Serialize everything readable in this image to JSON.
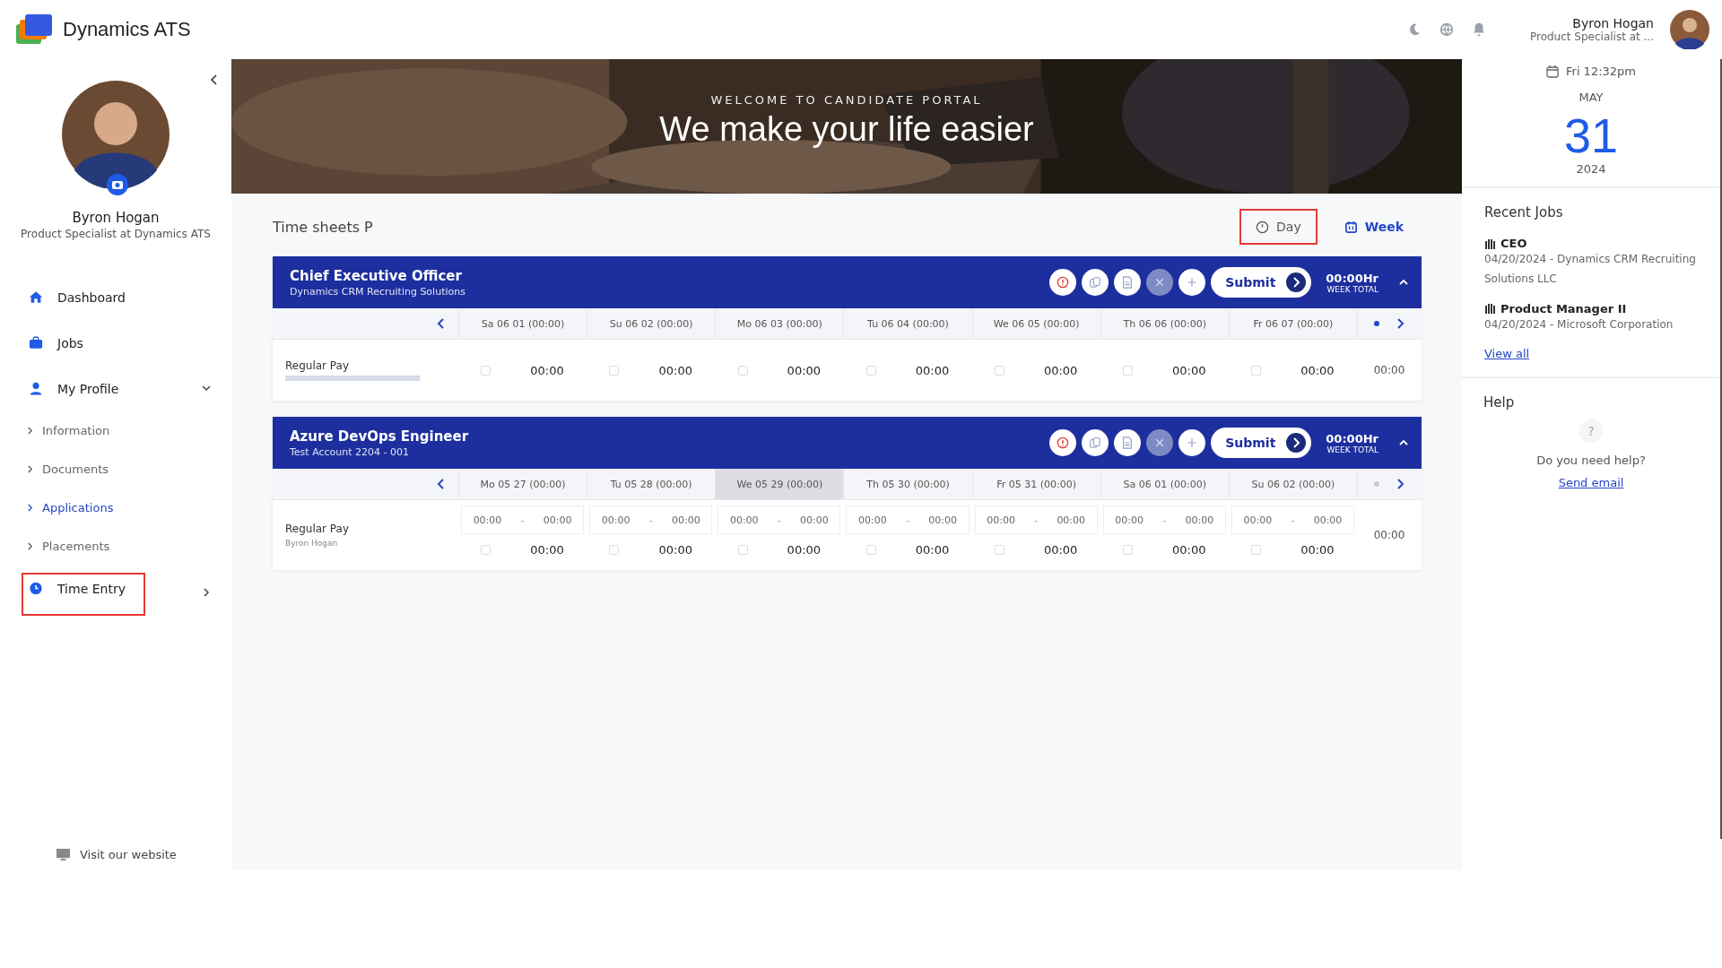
{
  "app": {
    "name": "Dynamics ATS"
  },
  "header": {
    "user_name": "Byron Hogan",
    "user_title": "Product Specialist at ..."
  },
  "sidebar": {
    "profile": {
      "name": "Byron Hogan",
      "title": "Product Specialist at Dynamics ATS"
    },
    "nav": [
      {
        "label": "Dashboard",
        "kind": "main",
        "selected": false,
        "highlighted": false
      },
      {
        "label": "Jobs",
        "kind": "main",
        "selected": false,
        "highlighted": false
      },
      {
        "label": "My Profile",
        "kind": "main",
        "selected": false,
        "highlighted": false,
        "expanded": true
      },
      {
        "label": "Information",
        "kind": "sub",
        "selected": false
      },
      {
        "label": "Documents",
        "kind": "sub",
        "selected": false
      },
      {
        "label": "Applications",
        "kind": "sub",
        "selected": true
      },
      {
        "label": "Placements",
        "kind": "sub",
        "selected": false
      },
      {
        "label": "Time Entry",
        "kind": "main",
        "selected": false,
        "highlighted": true,
        "expanded": false
      }
    ],
    "footer_link": "Visit our website"
  },
  "banner": {
    "kicker": "WELCOME TO CANDIDATE PORTAL",
    "headline": "We make your life easier"
  },
  "timesheets": {
    "title": "Time sheets P",
    "views": [
      {
        "label": "Day",
        "selected": false,
        "highlighted": true
      },
      {
        "label": "Week",
        "selected": true,
        "highlighted": false
      }
    ],
    "cards": [
      {
        "title": "Chief Executive Officer",
        "subtitle": "Dynamics CRM Recruiting Solutions",
        "submit": "Submit",
        "week_total": "00:00Hr",
        "week_total_label": "WEEK TOTAL",
        "days": [
          {
            "label": "Sa 06 01 (00:00)",
            "selected": false
          },
          {
            "label": "Su 06 02 (00:00)",
            "selected": false
          },
          {
            "label": "Mo 06 03 (00:00)",
            "selected": false
          },
          {
            "label": "Tu 06 04 (00:00)",
            "selected": false
          },
          {
            "label": "We 06 05 (00:00)",
            "selected": false
          },
          {
            "label": "Th 06 06 (00:00)",
            "selected": false
          },
          {
            "label": "Fr 06 07 (00:00)",
            "selected": false
          }
        ],
        "rows": [
          {
            "label": "Regular Pay",
            "kind": "total",
            "total": "00:00",
            "cells": [
              {
                "value": "00:00",
                "checked": false
              },
              {
                "value": "00:00",
                "checked": false
              },
              {
                "value": "00:00",
                "checked": false
              },
              {
                "value": "00:00",
                "checked": false
              },
              {
                "value": "00:00",
                "checked": false
              },
              {
                "value": "00:00",
                "checked": false
              },
              {
                "value": "00:00",
                "checked": false
              }
            ]
          }
        ]
      },
      {
        "title": "Azure DevOps Engineer",
        "subtitle": "Test Account 2204 - 001",
        "submit": "Submit",
        "week_total": "00:00Hr",
        "week_total_label": "WEEK TOTAL",
        "days": [
          {
            "label": "Mo 05 27 (00:00)",
            "selected": false
          },
          {
            "label": "Tu 05 28 (00:00)",
            "selected": false
          },
          {
            "label": "We 05 29 (00:00)",
            "selected": true
          },
          {
            "label": "Th 05 30 (00:00)",
            "selected": false
          },
          {
            "label": "Fr 05 31 (00:00)",
            "selected": false
          },
          {
            "label": "Sa 06 01 (00:00)",
            "selected": false
          },
          {
            "label": "Su 06 02 (00:00)",
            "selected": false
          }
        ],
        "rows": [
          {
            "label": "Regular Pay",
            "sublabel": "Byron Hogan",
            "kind": "range",
            "total": "00:00",
            "cells": [
              {
                "start": "00:00",
                "separator": "-",
                "end": "00:00",
                "value": "00:00",
                "checked": false
              },
              {
                "start": "00:00",
                "separator": "-",
                "end": "00:00",
                "value": "00:00",
                "checked": false
              },
              {
                "start": "00:00",
                "separator": "-",
                "end": "00:00",
                "value": "00:00",
                "checked": false
              },
              {
                "start": "00:00",
                "separator": "-",
                "end": "00:00",
                "value": "00:00",
                "checked": false
              },
              {
                "start": "00:00",
                "separator": "-",
                "end": "00:00",
                "value": "00:00",
                "checked": false
              },
              {
                "start": "00:00",
                "separator": "-",
                "end": "00:00",
                "value": "00:00",
                "checked": false
              },
              {
                "start": "00:00",
                "separator": "-",
                "end": "00:00",
                "value": "00:00",
                "checked": false
              }
            ]
          }
        ]
      }
    ]
  },
  "date": {
    "time": "Fri 12:32pm",
    "month": "MAY",
    "day": "31",
    "year": "2024"
  },
  "recent_jobs": {
    "title": "Recent Jobs",
    "items": [
      {
        "title": "CEO",
        "detail": "04/20/2024 - Dynamics CRM Recruiting Solutions LLC"
      },
      {
        "title": "Product Manager II",
        "detail": "04/20/2024 - Microsoft Corporation"
      }
    ],
    "view_all": "View all"
  },
  "help": {
    "title": "Help",
    "icon_text": "?",
    "question": "Do you need help?",
    "link": "Send email"
  }
}
